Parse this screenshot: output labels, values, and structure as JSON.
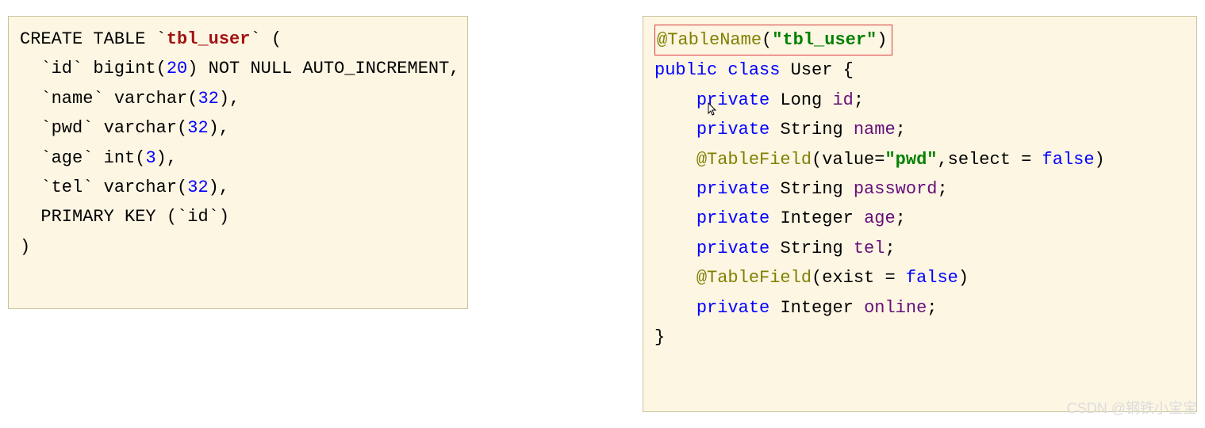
{
  "sql": {
    "create": "CREATE",
    "table": "TABLE",
    "tableName": "tbl_user",
    "open": "(",
    "col_id_name": "id",
    "col_id_type": "bigint",
    "col_id_len": "20",
    "col_id_rest": "NOT NULL AUTO_INCREMENT,",
    "col_name_name": "name",
    "col_name_type": "varchar",
    "col_name_len": "32",
    "col_pwd_name": "pwd",
    "col_pwd_type": "varchar",
    "col_pwd_len": "32",
    "col_age_name": "age",
    "col_age_type": "int",
    "col_age_len": "3",
    "col_tel_name": "tel",
    "col_tel_type": "varchar",
    "col_tel_len": "32",
    "pk": "PRIMARY KEY",
    "pk_col": "id",
    "close": ")"
  },
  "java": {
    "annoTableName": "@TableName",
    "strTbl": "\"tbl_user\"",
    "kw_public": "public",
    "kw_class": "class",
    "className": "User",
    "brace_open": "{",
    "kw_private": "private",
    "t_long": "Long",
    "t_string": "String",
    "t_integer": "Integer",
    "f_id": "id",
    "f_name": "name",
    "f_password": "password",
    "f_age": "age",
    "f_tel": "tel",
    "f_online": "online",
    "annoTableField1_pre": "@TableField",
    "annoTableField1_val": "value=",
    "annoTableField1_str": "\"pwd\"",
    "annoTableField1_sel": ",select = ",
    "annoTableField1_false": "false",
    "annoTableField2_pre": "@TableField",
    "annoTableField2_exist": "(exist = ",
    "annoTableField2_false": "false",
    "brace_close": "}",
    "semi": ";",
    "comma": ",",
    "paren_close": ")"
  },
  "watermark": "CSDN @钢铁小宝宝"
}
